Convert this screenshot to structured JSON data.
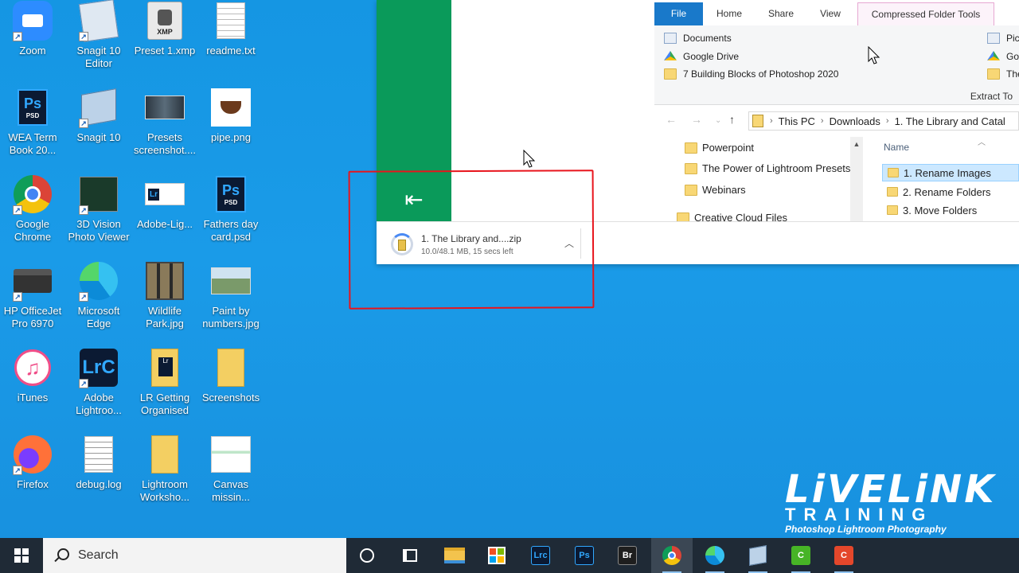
{
  "desktop": {
    "icons": [
      {
        "label": "Zoom",
        "icon": "zoom-icon",
        "color": "#2d8cff"
      },
      {
        "label": "Snagit 10 Editor",
        "icon": "snagit-editor-icon",
        "color": "#6c8fb5"
      },
      {
        "label": "Preset 1.xmp",
        "icon": "xmp-file-icon",
        "color": "#e0e0e0",
        "badge": "XMP"
      },
      {
        "label": "readme.txt",
        "icon": "text-file-icon",
        "color": "#ffffff"
      },
      {
        "label": "WEA Term Book 20...",
        "icon": "photoshop-file-icon",
        "color": "#0b1a33",
        "badge": "Ps"
      },
      {
        "label": "Snagit 10",
        "icon": "snagit-icon",
        "color": "#7fa4c8"
      },
      {
        "label": "Presets screenshot....",
        "icon": "image-file-icon",
        "color": "#3a4a55"
      },
      {
        "label": "pipe.png",
        "icon": "image-file-icon",
        "color": "#ffffff"
      },
      {
        "label": "Google Chrome",
        "icon": "chrome-icon",
        "color": "#db4437"
      },
      {
        "label": "3D Vision Photo Viewer",
        "icon": "3d-vision-icon",
        "color": "#1a3a2a"
      },
      {
        "label": "Adobe-Lig...",
        "icon": "lightroom-file-icon",
        "color": "#ffffff",
        "badge": "Lr"
      },
      {
        "label": "Fathers day card.psd",
        "icon": "photoshop-file-icon",
        "color": "#0b1a33",
        "badge": "Ps"
      },
      {
        "label": "HP OfficeJet Pro 6970",
        "icon": "printer-icon",
        "color": "#333333"
      },
      {
        "label": "Microsoft Edge",
        "icon": "edge-icon",
        "color": "#0c8bd8"
      },
      {
        "label": "Wildlife Park.jpg",
        "icon": "image-file-icon",
        "color": "#2a2a2a"
      },
      {
        "label": "Paint by numbers.jpg",
        "icon": "image-file-icon",
        "color": "#7a9a6a"
      },
      {
        "label": "iTunes",
        "icon": "itunes-icon",
        "color": "#f04e88"
      },
      {
        "label": "Adobe Lightroo...",
        "icon": "lightroom-classic-icon",
        "color": "#0b1a33",
        "badge": "LrC"
      },
      {
        "label": "LR Getting Organised",
        "icon": "folder-icon",
        "color": "#f3cf62"
      },
      {
        "label": "Screenshots",
        "icon": "folder-icon",
        "color": "#f3cf62"
      },
      {
        "label": "Firefox",
        "icon": "firefox-icon",
        "color": "#ff7139"
      },
      {
        "label": "debug.log",
        "icon": "text-file-icon",
        "color": "#ffffff"
      },
      {
        "label": "Lightroom Worksho...",
        "icon": "folder-icon",
        "color": "#f3cf62"
      },
      {
        "label": "Canvas missin...",
        "icon": "image-file-icon",
        "color": "#ffffff"
      }
    ]
  },
  "browser": {
    "download": {
      "filename": "1. The Library and....zip",
      "status": "10.0/48.1 MB, 15 secs left"
    }
  },
  "explorer": {
    "tabs": [
      "File",
      "Home",
      "Share",
      "View",
      "Compressed Folder Tools"
    ],
    "quick_access": [
      "Documents",
      "Google Drive",
      "7 Building Blocks of Photoshop 2020"
    ],
    "quick_access_right": [
      "Pict",
      "Go",
      "The"
    ],
    "extract_to": "Extract To",
    "breadcrumb": [
      "This PC",
      "Downloads",
      "1. The Library and Catal"
    ],
    "nav_items": [
      "Powerpoint",
      "The Power of Lightroom Presets",
      "Webinars",
      "Creative Cloud Files"
    ],
    "column_name": "Name",
    "files": [
      "1. Rename Images",
      "2. Rename Folders",
      "3. Move Folders"
    ]
  },
  "logo": {
    "main": "LiVELiNK",
    "sub": "TRAINING",
    "tag": "Photoshop Lightroom Photography"
  },
  "taskbar": {
    "search_placeholder": "Search",
    "apps": [
      {
        "name": "cortana-icon"
      },
      {
        "name": "task-view-icon"
      },
      {
        "name": "file-explorer-icon",
        "color": "#f3c34d"
      },
      {
        "name": "microsoft-store-icon",
        "color": "#0078d4"
      },
      {
        "name": "lightroom-classic-icon",
        "label": "Lrc",
        "color": "#0b1a33"
      },
      {
        "name": "photoshop-icon",
        "label": "Ps",
        "color": "#0b1a33"
      },
      {
        "name": "bridge-icon",
        "label": "Br",
        "color": "#1e1e1e"
      },
      {
        "name": "chrome-icon",
        "color": "#db4437"
      },
      {
        "name": "edge-icon",
        "color": "#0c8bd8"
      },
      {
        "name": "snagit-icon",
        "color": "#7fa4c8"
      },
      {
        "name": "camtasia-icon",
        "color": "#47b426"
      },
      {
        "name": "snagit-capture-icon",
        "color": "#e4472b"
      }
    ]
  },
  "colors": {
    "desktop": "#1596e3",
    "accent_green": "#0a9a5a",
    "annotation": "#e8141c",
    "taskbar": "#1f2a36"
  }
}
